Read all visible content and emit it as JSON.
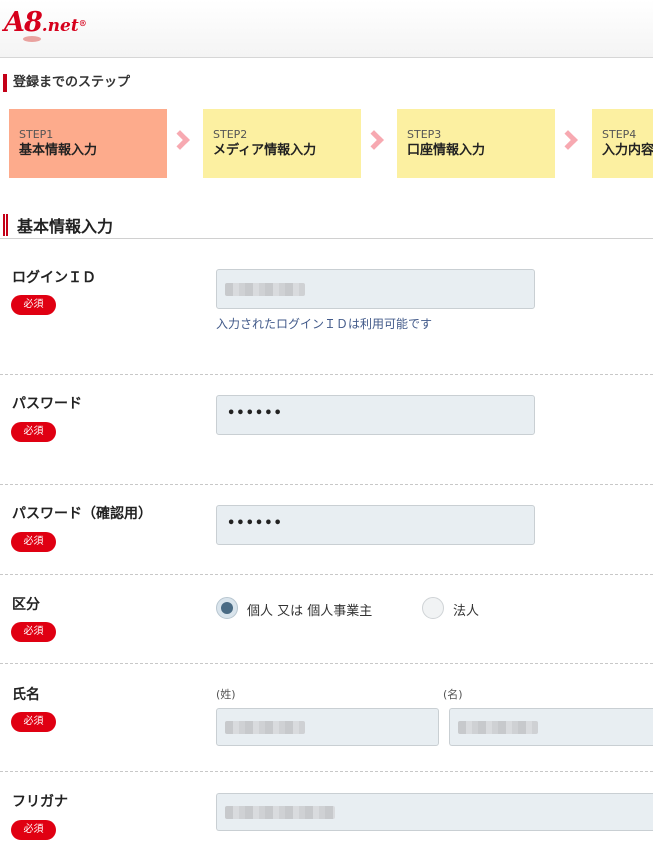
{
  "header": {
    "logo_main": "A8",
    "logo_suffix": ".net"
  },
  "steps_section": {
    "title": "登録までのステップ",
    "steps": [
      {
        "num": "STEP1",
        "name": "基本情報入力",
        "active": true
      },
      {
        "num": "STEP2",
        "name": "メディア情報入力",
        "active": false
      },
      {
        "num": "STEP3",
        "name": "口座情報入力",
        "active": false
      },
      {
        "num": "STEP4",
        "name": "入力内容",
        "active": false
      }
    ]
  },
  "form": {
    "section_title": "基本情報入力",
    "required_badge": "必須",
    "login_id": {
      "label": "ログインＩＤ",
      "value": "",
      "note": "入力されたログインＩＤは利用可能です"
    },
    "password": {
      "label": "パスワード",
      "value": "••••••"
    },
    "password_confirm": {
      "label": "パスワード（確認用）",
      "value": "••••••"
    },
    "category": {
      "label": "区分",
      "options": [
        {
          "label": "個人 又は 個人事業主",
          "selected": true
        },
        {
          "label": "法人",
          "selected": false
        }
      ]
    },
    "full_name": {
      "label": "氏名",
      "last_label": "(姓)",
      "first_label": "(名)"
    },
    "furigana": {
      "label": "フリガナ"
    }
  },
  "colors": {
    "brand": "#d6001c",
    "step_active": "#fdab8c",
    "step_inactive": "#fcf0a1",
    "badge": "#e00012",
    "input_bg": "#e8eef2"
  }
}
